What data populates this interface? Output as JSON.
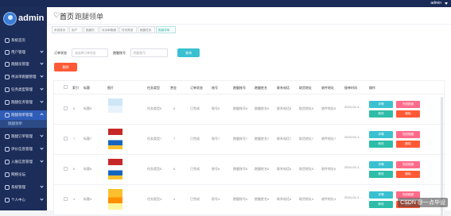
{
  "topbar": {
    "user": "admin"
  },
  "sidebar": {
    "username": "admin",
    "items": [
      {
        "label": "系统首页"
      },
      {
        "label": "用户管理"
      },
      {
        "label": "跑腿员管理"
      },
      {
        "label": "待派单跑腿管理"
      },
      {
        "label": "任务类型管理"
      },
      {
        "label": "跑腿任务管理"
      },
      {
        "label": "跑腿领单管理"
      },
      {
        "label": "跑腿领单"
      },
      {
        "label": "跑腿订单管理"
      },
      {
        "label": "评价信息管理"
      },
      {
        "label": "入账信息管理"
      },
      {
        "label": "网络论坛"
      },
      {
        "label": "系统管理"
      },
      {
        "label": "个人中心"
      }
    ]
  },
  "header": {
    "home": "首页",
    "title": "跑腿领单"
  },
  "tabs": [
    "系统首页",
    "用户",
    "跑腿员",
    "待派单跑腿",
    "任务类型",
    "跑腿任务",
    "跑腿领单"
  ],
  "search": {
    "status_label": "订单状态",
    "status_placeholder": "请选择订单状态",
    "runner_label": "跑腿账号",
    "runner_placeholder": "跑腿账号",
    "search_button": "查询"
  },
  "delete_button": "删除",
  "table": {
    "headers": [
      "",
      "索引",
      "标题",
      "图片",
      "任务类型",
      "赏金",
      "订单状态",
      "账号",
      "跑腿账号",
      "跑腿姓名",
      "联系电话",
      "取货地址",
      "收件地址",
      "接单时间",
      "操作"
    ],
    "rows": [
      {
        "index": "5",
        "title": "标题5",
        "type": "任务类型5",
        "reward": "5",
        "status": "已完成",
        "account": "账号5",
        "runner_account": "跑腿账号5",
        "runner_name": "跑腿姓名5",
        "phone": "联系电话5",
        "pickup": "取货地址5",
        "delivery": "收件地址5",
        "time": "2024-02-1..."
      },
      {
        "index": "7",
        "title": "标题7",
        "type": "任务类型7",
        "reward": "7",
        "status": "已完成",
        "account": "账号7",
        "runner_account": "跑腿账号7",
        "runner_name": "跑腿姓名7",
        "phone": "联系电话7",
        "pickup": "取货地址7",
        "delivery": "收件地址7",
        "time": "2024-02-1..."
      },
      {
        "index": "6",
        "title": "标题6",
        "type": "任务类型6",
        "reward": "6",
        "status": "已完成",
        "account": "账号6",
        "runner_account": "跑腿账号6",
        "runner_name": "跑腿姓名6",
        "phone": "联系电话6",
        "pickup": "取货地址6",
        "delivery": "收件地址6",
        "time": "2024-02-1..."
      },
      {
        "index": "4",
        "title": "标题4",
        "type": "任务类型4",
        "reward": "4",
        "status": "已完成",
        "account": "账号4",
        "runner_account": "跑腿账号4",
        "runner_name": "跑腿姓名4",
        "phone": "联系电话4",
        "pickup": "取货地址4",
        "delivery": "收件地址4",
        "time": "2024-02-1..."
      }
    ],
    "actions": {
      "view": "详情",
      "rate": "完成跑腿",
      "edit": "修改",
      "delete": "删除"
    }
  },
  "watermark": "CSDN @一点毕设",
  "colors": {
    "sidebar": "#1d2d5a",
    "accent": "#3ac1d1",
    "danger": "#ff5a36",
    "pink": "#ff6b8a"
  }
}
